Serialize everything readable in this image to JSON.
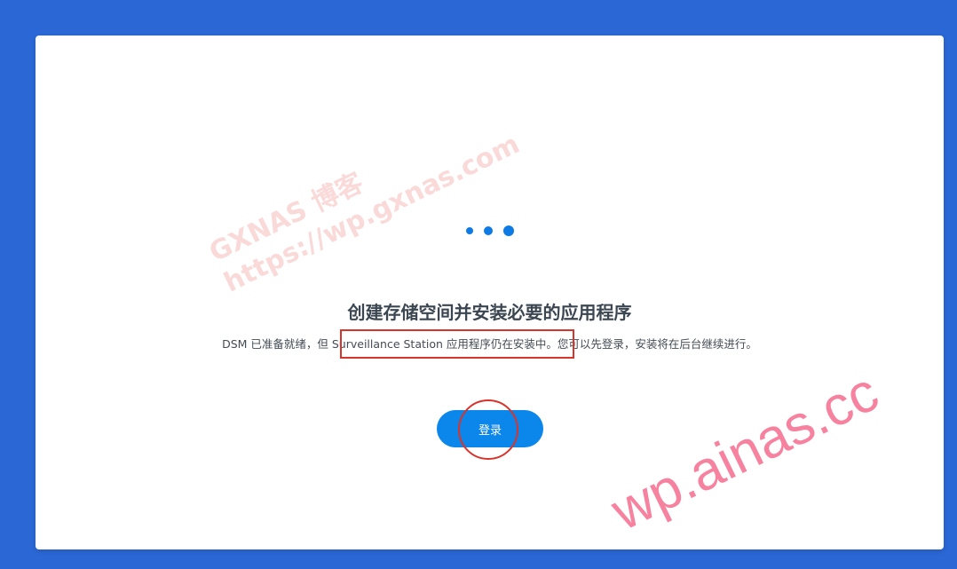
{
  "colors": {
    "background": "#2b68d6",
    "accent": "#0b86ea",
    "annotation": "#d9342b"
  },
  "loader": {
    "icon": "loading-dots-icon"
  },
  "main": {
    "title": "创建存储空间并安装必要的应用程序",
    "description": "DSM 已准备就绪，但 Surveillance Station 应用程序仍在安装中。您可以先登录，安装将在后台继续进行。"
  },
  "actions": {
    "login_label": "登录"
  },
  "watermarks": {
    "line1": "GXNAS 博客",
    "line2": "https://wp.gxnas.com",
    "corner": "wp.ainas.cc"
  }
}
